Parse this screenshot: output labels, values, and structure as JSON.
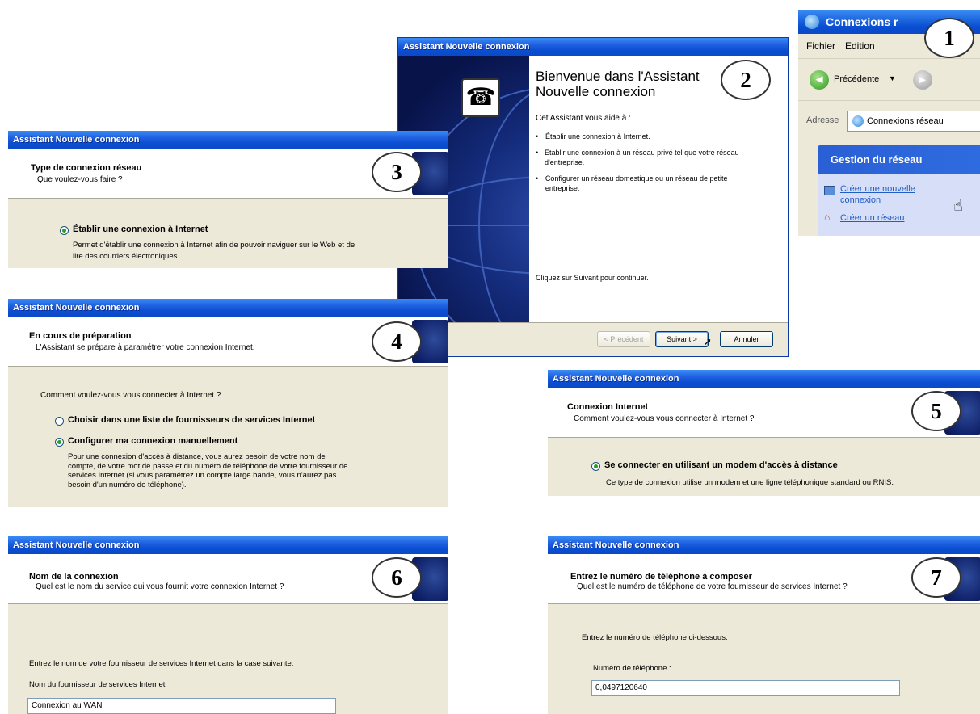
{
  "wizard_title": "Assistant Nouvelle connexion",
  "explorer": {
    "title": "Connexions r",
    "menu": [
      "Fichier",
      "Edition"
    ],
    "back_label": "Précédente",
    "address_label": "Adresse",
    "address_value": "Connexions réseau",
    "tasks_title": "Gestion du réseau",
    "task1": "Créer une nouvelle connexion",
    "task1_line1": "Créer une nouvelle",
    "task1_line2": "connexion",
    "task2": "Créer un réseau"
  },
  "welcome": {
    "heading_line1": "Bienvenue dans l'Assistant",
    "heading_line2": "Nouvelle connexion",
    "intro": "Cet Assistant vous aide à :",
    "bullets": [
      "Établir une connexion à Internet.",
      "Établir une connexion à un réseau privé tel que votre réseau d'entreprise.",
      "Configurer un réseau domestique ou un réseau de petite entreprise."
    ],
    "continue_text": "Cliquez sur Suivant pour continuer.",
    "btn_prev": "< Précédent",
    "btn_next": "Suivant >",
    "btn_cancel": "Annuler"
  },
  "steps": {
    "s3": {
      "title": "Type de connexion réseau",
      "subtitle": "Que voulez-vous faire ?",
      "option": "Établir une connexion à Internet",
      "option_desc_1": "Permet d'établir une connexion à Internet afin de pouvoir naviguer sur le Web et de",
      "option_desc_2": "lire des courriers électroniques."
    },
    "s4": {
      "title": "En cours de préparation",
      "subtitle": "L'Assistant se prépare à paramétrer votre connexion Internet.",
      "question": "Comment voulez-vous vous connecter à Internet ?",
      "option1": "Choisir dans une liste de fournisseurs de services Internet",
      "option2": "Configurer ma connexion manuellement",
      "desc": [
        "Pour une connexion d'accès à distance, vous aurez besoin de votre nom de",
        "compte, de votre mot de passe et du numéro de téléphone de votre fournisseur de",
        "services Internet (si vous paramétrez un compte large bande, vous n'aurez pas",
        "besoin d'un numéro de téléphone)."
      ]
    },
    "s5": {
      "title": "Connexion Internet",
      "subtitle": "Comment voulez-vous vous connecter à Internet ?",
      "option": "Se connecter en utilisant un modem d'accès à distance",
      "desc": "Ce type de connexion utilise un modem et une ligne téléphonique standard ou RNIS."
    },
    "s6": {
      "title": "Nom de la connexion",
      "subtitle": "Quel est le nom du service qui vous fournit votre connexion Internet ?",
      "instruction": "Entrez le nom de votre fournisseur de services Internet dans la case suivante.",
      "field_label": "Nom du fournisseur de services Internet",
      "field_value": "Connexion au WAN"
    },
    "s7": {
      "title": "Entrez le numéro de téléphone à composer",
      "subtitle": "Quel est le numéro de téléphone de votre fournisseur de services Internet ?",
      "instruction": "Entrez le numéro de téléphone ci-dessous.",
      "field_label": "Numéro de téléphone :",
      "field_value": "0,0497120640"
    }
  },
  "badges": [
    "1",
    "2",
    "3",
    "4",
    "5",
    "6",
    "7"
  ]
}
